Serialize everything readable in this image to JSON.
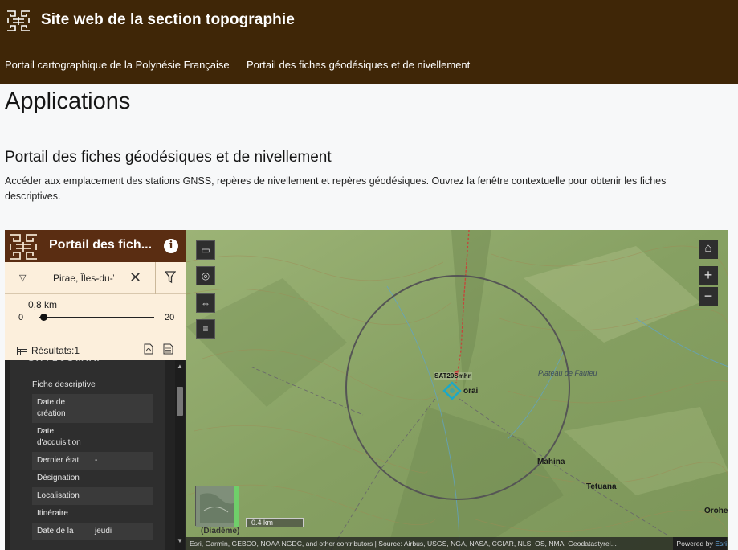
{
  "site": {
    "title": "Site web de la section topographie",
    "nav": [
      "Portail cartographique de la Polynésie Française",
      "Portail des fiches géodésiques et de nivellement"
    ]
  },
  "content": {
    "heading": "Applications",
    "subheading": "Portail des fiches géodésiques et de nivellement",
    "description": "Accéder aux emplacement des stations GNSS, repères de nivellement et repères géodésiques. Ouvrez la fenêtre contextuelle pour obtenir les fiches descriptives."
  },
  "app": {
    "title": "Portail des fich...",
    "search": {
      "value": "Pirae, Îles-du-V"
    },
    "slider": {
      "value_label": "0,8 km",
      "min": "0",
      "max": "20",
      "fraction": 0.04
    },
    "results": {
      "label": "Résultats:1"
    },
    "list": {
      "section_label": "Fiche descriptive",
      "rows": [
        {
          "key": "Date de création",
          "value": ""
        },
        {
          "key": "Date d'acquisition",
          "value": ""
        },
        {
          "key": "Dernier état",
          "value": "-"
        },
        {
          "key": "Désignation",
          "value": ""
        },
        {
          "key": "Localisation",
          "value": ""
        },
        {
          "key": "Itinéraire",
          "value": ""
        },
        {
          "key": "Date de la",
          "value": "jeudi"
        }
      ]
    }
  },
  "map": {
    "station_label": "SAT20Smhn",
    "places": {
      "orai": "orai",
      "plateau": "Plateau de Faufeu",
      "mahina": "Mahina",
      "tetuana": "Tetuana",
      "orohe": "Orohe"
    },
    "overview_label": "(Diadème)",
    "scale_label": "0.4 km",
    "attribution": "Esri, Garmin, GEBCO, NOAA NGDC, and other contributors | Source: Airbus, USGS, NGA, NASA, CGIAR, NLS, OS, NMA, Geodatastyrel...",
    "powered_prefix": "Powered by ",
    "powered_brand": "Esri",
    "zoom_in": "+",
    "zoom_out": "−"
  },
  "colors": {
    "header_brown": "#3f2607",
    "panel_brown": "#5a2d12",
    "panel_cream": "#fcefdc",
    "map_green": "#8fa86a"
  }
}
